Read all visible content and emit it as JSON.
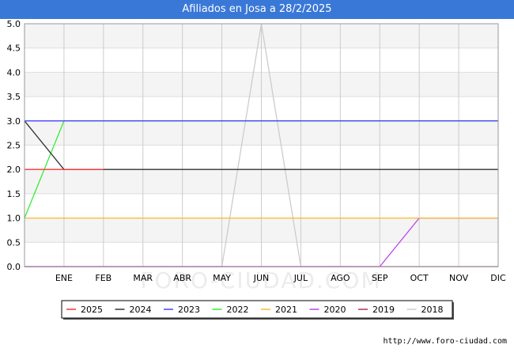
{
  "title": "Afiliados en Josa a 28/2/2025",
  "source": "http://www.foro-ciudad.com",
  "watermark": "FORO-CIUDAD.COM",
  "chart_data": {
    "type": "line",
    "categories": [
      "ENE",
      "FEB",
      "MAR",
      "ABR",
      "MAY",
      "JUN",
      "JUL",
      "AGO",
      "SEP",
      "OCT",
      "NOV",
      "DIC"
    ],
    "x_start_label": "",
    "ylim": [
      0,
      5
    ],
    "yticks": [
      0.0,
      0.5,
      1.0,
      1.5,
      2.0,
      2.5,
      3.0,
      3.5,
      4.0,
      4.5,
      5.0
    ],
    "grid": true,
    "legend_position": "bottom",
    "series": [
      {
        "name": "2025",
        "color": "#ff3333",
        "values": [
          2,
          2,
          2
        ]
      },
      {
        "name": "2024",
        "color": "#333333",
        "values": [
          3,
          2,
          2,
          2,
          2,
          2,
          2,
          2,
          2,
          2,
          2,
          2,
          2
        ]
      },
      {
        "name": "2023",
        "color": "#4444ff",
        "values": [
          3,
          3,
          3,
          3,
          3,
          3,
          3,
          3,
          3,
          3,
          3,
          3,
          3
        ]
      },
      {
        "name": "2022",
        "color": "#33ee33",
        "values": [
          1,
          3,
          3,
          3,
          3,
          3,
          3,
          3,
          3,
          3,
          3,
          3,
          3
        ]
      },
      {
        "name": "2021",
        "color": "#ffb833",
        "values": [
          1,
          1,
          1,
          1,
          1,
          1,
          1,
          1,
          1,
          1,
          1,
          1,
          1
        ]
      },
      {
        "name": "2020",
        "color": "#bb44ee",
        "values": [
          0,
          0,
          0,
          0,
          0,
          0,
          0,
          0,
          0,
          0,
          1,
          1,
          1
        ]
      },
      {
        "name": "2019",
        "color": "#aa3366",
        "values": [
          0,
          0,
          0,
          0,
          0,
          0,
          0,
          0,
          0,
          0,
          0,
          0,
          0
        ]
      },
      {
        "name": "2018",
        "color": "#cccccc",
        "values": [
          0,
          0,
          0,
          0,
          0,
          0,
          5,
          0,
          0,
          0,
          0,
          0,
          0
        ]
      }
    ]
  }
}
